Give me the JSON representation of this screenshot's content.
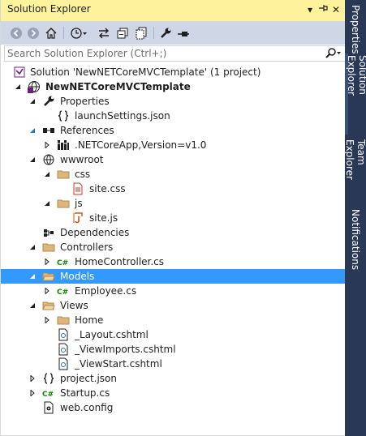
{
  "window": {
    "title": "Solution Explorer",
    "dropdown_glyph": "▾",
    "pin_glyph": "⊣",
    "close_glyph": "✕"
  },
  "toolbar": {
    "items": [
      "back-icon",
      "forward-icon",
      "home-icon",
      "history-icon",
      "sync-icon",
      "collapse-all-icon",
      "show-all-files-icon",
      "properties-wrench-icon",
      "preview-icon"
    ]
  },
  "search": {
    "placeholder": "Search Solution Explorer (Ctrl+;)"
  },
  "tree": {
    "solution": "Solution 'NewNETCoreMVCTemplate' (1 project)",
    "project": "NewNETCoreMVCTemplate",
    "properties": "Properties",
    "launch_settings": "launchSettings.json",
    "references": "References",
    "netcoreapp": ".NETCoreApp,Version=v1.0",
    "wwwroot": "wwwroot",
    "css": "css",
    "site_css": "site.css",
    "js": "js",
    "site_js": "site.js",
    "dependencies": "Dependencies",
    "controllers": "Controllers",
    "home_controller": "HomeController.cs",
    "models": "Models",
    "employee": "Employee.cs",
    "views": "Views",
    "home": "Home",
    "layout": "_Layout.cshtml",
    "view_imports": "_ViewImports.cshtml",
    "view_start": "_ViewStart.cshtml",
    "project_json": "project.json",
    "startup": "Startup.cs",
    "web_config": "web.config"
  },
  "side_tabs": {
    "properties": "Properties",
    "solution_explorer": "Solution Explorer",
    "team_explorer": "Team Explorer",
    "notifications": "Notifications"
  },
  "colors": {
    "title_bar": "#fff29d",
    "toolbar": "#cfd6e5",
    "selection": "#3399ff",
    "side_bar": "#293955",
    "folder": "#dcb67a",
    "csharp": "#178600",
    "vs_purple": "#68217a"
  }
}
